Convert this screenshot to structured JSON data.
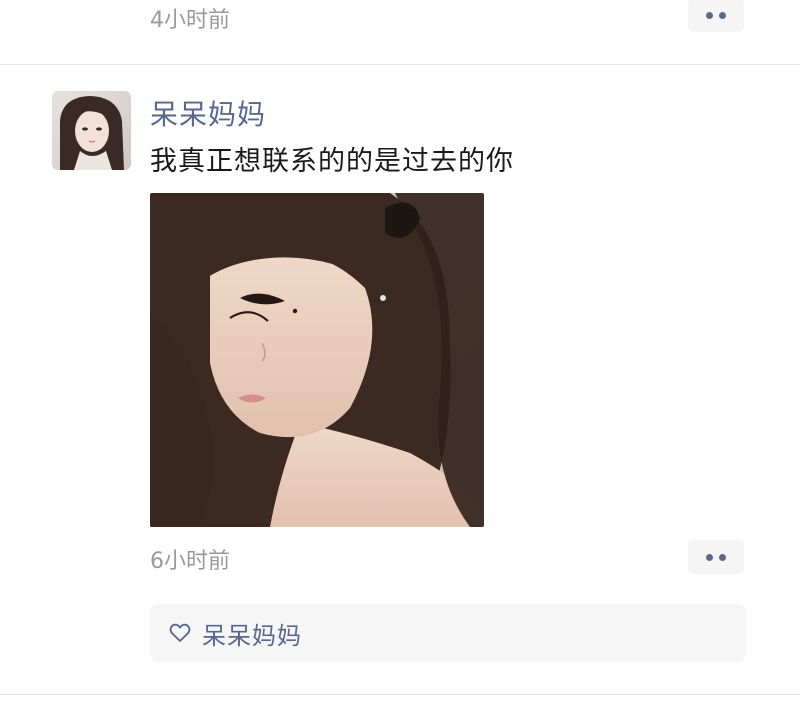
{
  "previous_post": {
    "time": "4小时前",
    "more_icon": "more-dots-icon"
  },
  "post": {
    "username": "呆呆妈妈",
    "text": "我真正想联系的的是过去的你",
    "time": "6小时前",
    "more_icon": "more-dots-icon",
    "avatar_icon": "avatar-image",
    "photo_icon": "photo-image"
  },
  "likes": {
    "icon": "heart-icon",
    "names": "呆呆妈妈"
  },
  "colors": {
    "name_blue": "#57678e",
    "timestamp_gray": "#9a9a9a",
    "panel_bg": "#f6f6f7"
  }
}
